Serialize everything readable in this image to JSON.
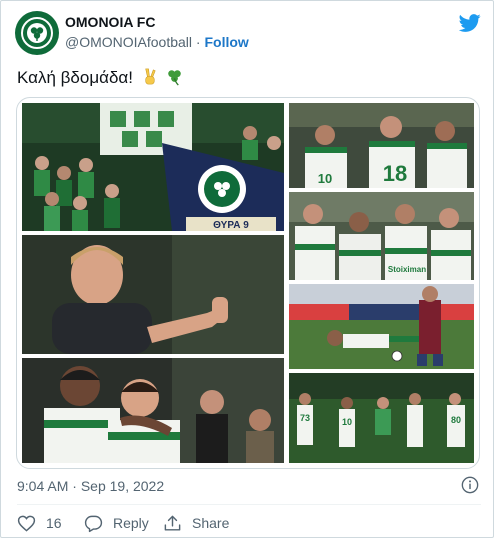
{
  "account": {
    "name": "OMONOIA FC",
    "handle": "@OMONOIAfootball",
    "separator": "·",
    "follow_label": "Follow"
  },
  "tweet": {
    "text": "Καλή βδομάδα!",
    "emojis": [
      "victory-hand",
      "shamrock"
    ]
  },
  "meta": {
    "time": "9:04 AM",
    "separator": "·",
    "date": "Sep 19, 2022"
  },
  "actions": {
    "like_count": "16",
    "reply_label": "Reply",
    "share_label": "Share"
  },
  "photo_text": {
    "flag_text": "ΘΥΡΑ 9",
    "shirt_numbers": [
      "10",
      "18",
      "73",
      "10",
      "80"
    ],
    "board_text": "Stoiximan"
  },
  "colors": {
    "brand_green": "#0f6b3a",
    "link_blue": "#1d77c8",
    "twitter_blue": "#1d9bf0",
    "muted_text": "#536471"
  }
}
